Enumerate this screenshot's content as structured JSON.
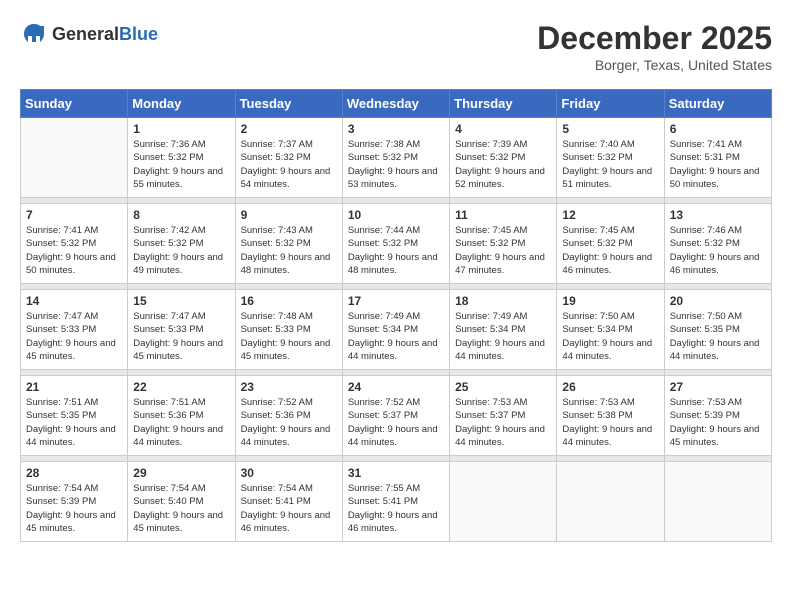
{
  "logo": {
    "general": "General",
    "blue": "Blue"
  },
  "title": "December 2025",
  "subtitle": "Borger, Texas, United States",
  "days_of_week": [
    "Sunday",
    "Monday",
    "Tuesday",
    "Wednesday",
    "Thursday",
    "Friday",
    "Saturday"
  ],
  "weeks": [
    [
      {
        "day": "",
        "sunrise": "",
        "sunset": "",
        "daylight": "",
        "empty": true
      },
      {
        "day": "1",
        "sunrise": "Sunrise: 7:36 AM",
        "sunset": "Sunset: 5:32 PM",
        "daylight": "Daylight: 9 hours and 55 minutes."
      },
      {
        "day": "2",
        "sunrise": "Sunrise: 7:37 AM",
        "sunset": "Sunset: 5:32 PM",
        "daylight": "Daylight: 9 hours and 54 minutes."
      },
      {
        "day": "3",
        "sunrise": "Sunrise: 7:38 AM",
        "sunset": "Sunset: 5:32 PM",
        "daylight": "Daylight: 9 hours and 53 minutes."
      },
      {
        "day": "4",
        "sunrise": "Sunrise: 7:39 AM",
        "sunset": "Sunset: 5:32 PM",
        "daylight": "Daylight: 9 hours and 52 minutes."
      },
      {
        "day": "5",
        "sunrise": "Sunrise: 7:40 AM",
        "sunset": "Sunset: 5:32 PM",
        "daylight": "Daylight: 9 hours and 51 minutes."
      },
      {
        "day": "6",
        "sunrise": "Sunrise: 7:41 AM",
        "sunset": "Sunset: 5:31 PM",
        "daylight": "Daylight: 9 hours and 50 minutes."
      }
    ],
    [
      {
        "day": "7",
        "sunrise": "Sunrise: 7:41 AM",
        "sunset": "Sunset: 5:32 PM",
        "daylight": "Daylight: 9 hours and 50 minutes."
      },
      {
        "day": "8",
        "sunrise": "Sunrise: 7:42 AM",
        "sunset": "Sunset: 5:32 PM",
        "daylight": "Daylight: 9 hours and 49 minutes."
      },
      {
        "day": "9",
        "sunrise": "Sunrise: 7:43 AM",
        "sunset": "Sunset: 5:32 PM",
        "daylight": "Daylight: 9 hours and 48 minutes."
      },
      {
        "day": "10",
        "sunrise": "Sunrise: 7:44 AM",
        "sunset": "Sunset: 5:32 PM",
        "daylight": "Daylight: 9 hours and 48 minutes."
      },
      {
        "day": "11",
        "sunrise": "Sunrise: 7:45 AM",
        "sunset": "Sunset: 5:32 PM",
        "daylight": "Daylight: 9 hours and 47 minutes."
      },
      {
        "day": "12",
        "sunrise": "Sunrise: 7:45 AM",
        "sunset": "Sunset: 5:32 PM",
        "daylight": "Daylight: 9 hours and 46 minutes."
      },
      {
        "day": "13",
        "sunrise": "Sunrise: 7:46 AM",
        "sunset": "Sunset: 5:32 PM",
        "daylight": "Daylight: 9 hours and 46 minutes."
      }
    ],
    [
      {
        "day": "14",
        "sunrise": "Sunrise: 7:47 AM",
        "sunset": "Sunset: 5:33 PM",
        "daylight": "Daylight: 9 hours and 45 minutes."
      },
      {
        "day": "15",
        "sunrise": "Sunrise: 7:47 AM",
        "sunset": "Sunset: 5:33 PM",
        "daylight": "Daylight: 9 hours and 45 minutes."
      },
      {
        "day": "16",
        "sunrise": "Sunrise: 7:48 AM",
        "sunset": "Sunset: 5:33 PM",
        "daylight": "Daylight: 9 hours and 45 minutes."
      },
      {
        "day": "17",
        "sunrise": "Sunrise: 7:49 AM",
        "sunset": "Sunset: 5:34 PM",
        "daylight": "Daylight: 9 hours and 44 minutes."
      },
      {
        "day": "18",
        "sunrise": "Sunrise: 7:49 AM",
        "sunset": "Sunset: 5:34 PM",
        "daylight": "Daylight: 9 hours and 44 minutes."
      },
      {
        "day": "19",
        "sunrise": "Sunrise: 7:50 AM",
        "sunset": "Sunset: 5:34 PM",
        "daylight": "Daylight: 9 hours and 44 minutes."
      },
      {
        "day": "20",
        "sunrise": "Sunrise: 7:50 AM",
        "sunset": "Sunset: 5:35 PM",
        "daylight": "Daylight: 9 hours and 44 minutes."
      }
    ],
    [
      {
        "day": "21",
        "sunrise": "Sunrise: 7:51 AM",
        "sunset": "Sunset: 5:35 PM",
        "daylight": "Daylight: 9 hours and 44 minutes."
      },
      {
        "day": "22",
        "sunrise": "Sunrise: 7:51 AM",
        "sunset": "Sunset: 5:36 PM",
        "daylight": "Daylight: 9 hours and 44 minutes."
      },
      {
        "day": "23",
        "sunrise": "Sunrise: 7:52 AM",
        "sunset": "Sunset: 5:36 PM",
        "daylight": "Daylight: 9 hours and 44 minutes."
      },
      {
        "day": "24",
        "sunrise": "Sunrise: 7:52 AM",
        "sunset": "Sunset: 5:37 PM",
        "daylight": "Daylight: 9 hours and 44 minutes."
      },
      {
        "day": "25",
        "sunrise": "Sunrise: 7:53 AM",
        "sunset": "Sunset: 5:37 PM",
        "daylight": "Daylight: 9 hours and 44 minutes."
      },
      {
        "day": "26",
        "sunrise": "Sunrise: 7:53 AM",
        "sunset": "Sunset: 5:38 PM",
        "daylight": "Daylight: 9 hours and 44 minutes."
      },
      {
        "day": "27",
        "sunrise": "Sunrise: 7:53 AM",
        "sunset": "Sunset: 5:39 PM",
        "daylight": "Daylight: 9 hours and 45 minutes."
      }
    ],
    [
      {
        "day": "28",
        "sunrise": "Sunrise: 7:54 AM",
        "sunset": "Sunset: 5:39 PM",
        "daylight": "Daylight: 9 hours and 45 minutes."
      },
      {
        "day": "29",
        "sunrise": "Sunrise: 7:54 AM",
        "sunset": "Sunset: 5:40 PM",
        "daylight": "Daylight: 9 hours and 45 minutes."
      },
      {
        "day": "30",
        "sunrise": "Sunrise: 7:54 AM",
        "sunset": "Sunset: 5:41 PM",
        "daylight": "Daylight: 9 hours and 46 minutes."
      },
      {
        "day": "31",
        "sunrise": "Sunrise: 7:55 AM",
        "sunset": "Sunset: 5:41 PM",
        "daylight": "Daylight: 9 hours and 46 minutes."
      },
      {
        "day": "",
        "sunrise": "",
        "sunset": "",
        "daylight": "",
        "empty": true
      },
      {
        "day": "",
        "sunrise": "",
        "sunset": "",
        "daylight": "",
        "empty": true
      },
      {
        "day": "",
        "sunrise": "",
        "sunset": "",
        "daylight": "",
        "empty": true
      }
    ]
  ]
}
